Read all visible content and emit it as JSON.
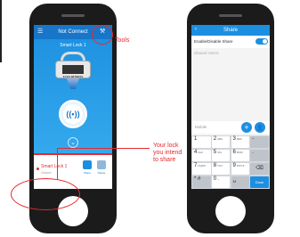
{
  "screen1": {
    "header": {
      "title": "Not Connect",
      "menu_icon": "hamburger-icon",
      "tools_icon": "tools-icon"
    },
    "lock_name_top": "Smart Lock 1",
    "lock_brand": "EYES WITNESS",
    "unlock_icon": "broadcast-icon",
    "lock_item": {
      "name": "Smart Lock 1",
      "role": "Owner"
    },
    "actions": [
      {
        "label": "Share"
      },
      {
        "label": "Delete"
      }
    ]
  },
  "screen2": {
    "header": {
      "title": "Share"
    },
    "toggle_label": "Enable/Disable Share",
    "toggle_on": true,
    "shared_users_label": "Shared Users",
    "mobile_placeholder": "Mobile",
    "keypad": {
      "rows": [
        [
          {
            "num": "1",
            "sub": ""
          },
          {
            "num": "2",
            "sub": "ABC"
          },
          {
            "num": "3",
            "sub": "DEF"
          },
          {
            "num": "-",
            "sub": ""
          }
        ],
        [
          {
            "num": "4",
            "sub": "GHI"
          },
          {
            "num": "5",
            "sub": "JKL"
          },
          {
            "num": "6",
            "sub": "MNO"
          },
          {
            "num": ".",
            "sub": ""
          }
        ],
        [
          {
            "num": "7",
            "sub": "PQRS"
          },
          {
            "num": "8",
            "sub": "TUV"
          },
          {
            "num": "9",
            "sub": "WXYZ"
          },
          {
            "num": "⌫",
            "sub": ""
          }
        ],
        [
          {
            "num": "* #",
            "sub": ""
          },
          {
            "num": "0",
            "sub": "+"
          },
          {
            "num": "␣",
            "sub": ""
          },
          {
            "num": "Done",
            "sub": ""
          }
        ]
      ]
    }
  },
  "annotations": {
    "tools": "Tools",
    "lock_callout": [
      "Your lock",
      "you intend",
      "to share"
    ]
  },
  "colors": {
    "accent": "#1d8fe0",
    "annotation": "#e7292f"
  }
}
